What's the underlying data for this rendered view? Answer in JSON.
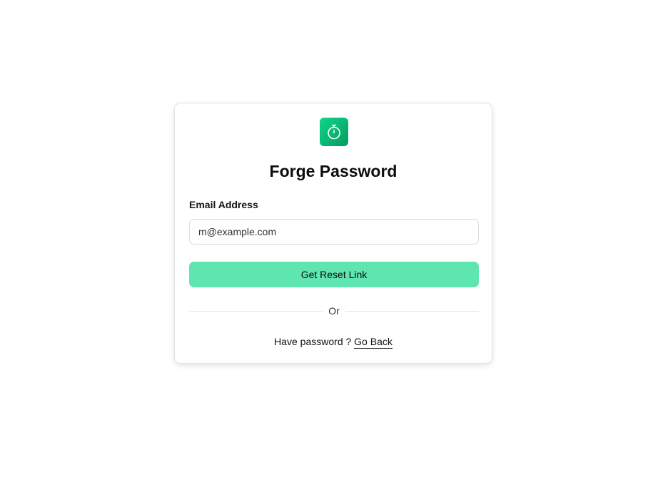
{
  "logo": {
    "icon": "stopwatch-icon",
    "gradient_start": "#0fd58a",
    "gradient_end": "#069a5e"
  },
  "title": "Forge Password",
  "form": {
    "email_label": "Email Address",
    "email_placeholder": "m@example.com",
    "submit_label": "Get Reset Link",
    "submit_color": "#5fe5b0"
  },
  "divider_text": "Or",
  "footer": {
    "prompt": "Have password ?",
    "link_label": "Go Back"
  }
}
